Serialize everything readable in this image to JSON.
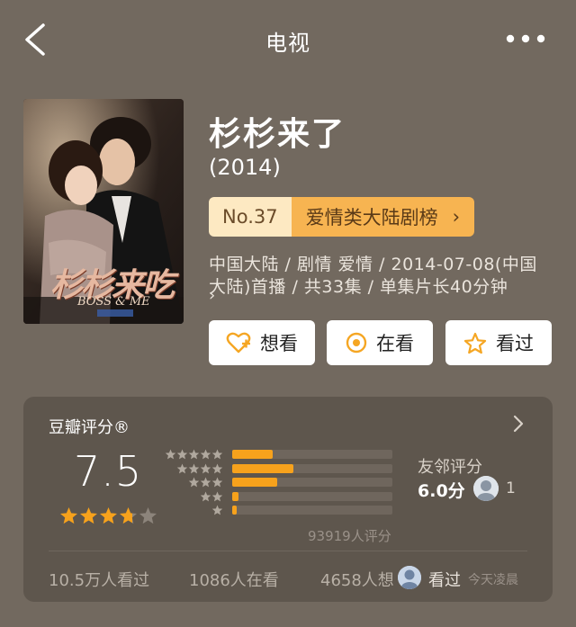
{
  "nav": {
    "title": "电视",
    "back_icon": "chevron-left-icon",
    "more_icon": "more-horizontal-icon"
  },
  "poster": {
    "title_script": "杉杉来吃",
    "subtitle_script": "BOSS & ME",
    "colors": {
      "bg": "#2a1f1a",
      "accent": "#e6b8a0"
    }
  },
  "show": {
    "title": "杉杉来了",
    "year": "(2014)",
    "rank": {
      "number": "No.37",
      "category": "爱情类大陆剧榜",
      "chevron": "›"
    },
    "meta_line": "中国大陆 / 剧情 爱情 / 2014-07-08(中国大陆)首播 / 共33集 / 单集片长40分钟",
    "meta_chevron": "›"
  },
  "actions": [
    {
      "label": "想看",
      "icon": "heart-plus-icon"
    },
    {
      "label": "在看",
      "icon": "target-icon"
    },
    {
      "label": "看过",
      "icon": "star-outline-icon"
    }
  ],
  "rating": {
    "title": "豆瓣评分®",
    "score": "7.5",
    "stars": 3.75,
    "distribution": [
      {
        "stars": 5,
        "fraction": 0.25
      },
      {
        "stars": 4,
        "fraction": 0.38
      },
      {
        "stars": 3,
        "fraction": 0.28
      },
      {
        "stars": 2,
        "fraction": 0.04
      },
      {
        "stars": 1,
        "fraction": 0.03
      }
    ],
    "count_label": "93919人评分",
    "friends": {
      "label": "友邻评分",
      "score": "6.0分",
      "count": "1"
    }
  },
  "stats": {
    "watched": "10.5万人看过",
    "watching": "1086人在看",
    "want": "4658人想",
    "seen_label": "看过",
    "time": "今天凌晨"
  },
  "colors": {
    "background": "#72695f",
    "card": "#5e564d",
    "rank_light": "#fde9c2",
    "rank_dark": "#f7b451",
    "star": "#f7a21c",
    "action_icon": "#f5a623"
  }
}
